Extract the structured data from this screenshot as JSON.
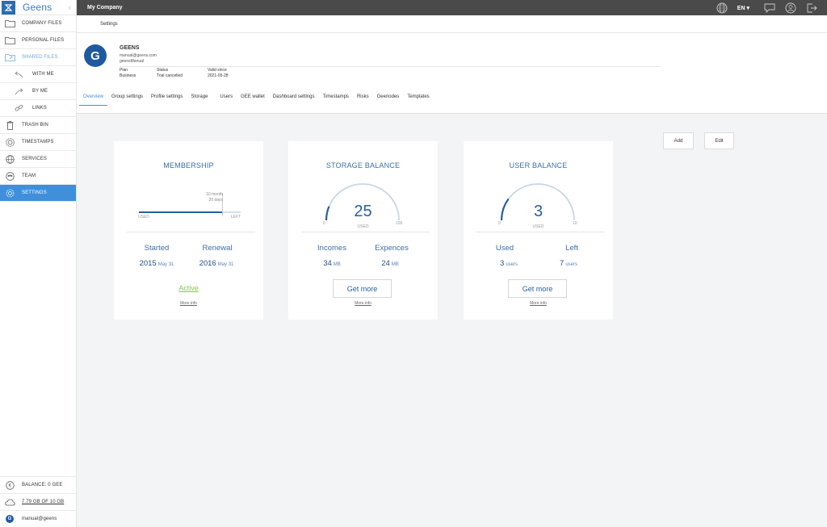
{
  "brand": {
    "name": "Geens"
  },
  "sidebar": {
    "items": [
      {
        "label": "COMPANY FILES",
        "icon": "folder-icon"
      },
      {
        "label": "PERSONAL FILES",
        "icon": "folder-icon"
      },
      {
        "label": "SHARED FILES",
        "icon": "shared-folder-icon"
      },
      {
        "label": "WITH ME",
        "icon": "arrow-back-icon"
      },
      {
        "label": "BY ME",
        "icon": "arrow-forward-icon"
      },
      {
        "label": "LINKS",
        "icon": "link-icon"
      },
      {
        "label": "TRASH BIN",
        "icon": "trash-icon"
      },
      {
        "label": "TIMESTAMPS",
        "icon": "timestamp-icon"
      },
      {
        "label": "SERVICES",
        "icon": "globe-icon"
      },
      {
        "label": "TEAM",
        "icon": "team-icon"
      },
      {
        "label": "SETTINGS",
        "icon": "gear-icon"
      }
    ],
    "bottom": {
      "balance": "BALANCE: 0 GEE",
      "storage": "7.79 GB OF 10 GB",
      "user": "manual@geens"
    }
  },
  "topbar": {
    "company": "My Company",
    "language": "EN"
  },
  "breadcrumb": "Settings",
  "profile": {
    "name": "GEENS",
    "email": "manual@geens.com",
    "username": "geensManual",
    "plan_label": "Plan",
    "plan_value": "Business",
    "status_label": "Status",
    "status_value": "Trial cancelled",
    "valid_label": "Valid since",
    "valid_value": "2021-05-28"
  },
  "tabs": [
    "Overview",
    "Group settings",
    "Profile settings",
    "Storage",
    "Users",
    "GEE wallet",
    "Dashboard settings",
    "Timestamps",
    "Risks",
    "Geenodes",
    "Templates"
  ],
  "actions": {
    "add": "Add",
    "edit": "Edit"
  },
  "membership": {
    "title": "MEMBERSHIP",
    "remaining": "10 month",
    "remaining_days": "20 days",
    "used_label": "USED",
    "left_label": "LEFT",
    "progress_used_fraction": 0.82,
    "started_label": "Started",
    "started_year": "2015",
    "started_date": "May 31",
    "renewal_label": "Renewal",
    "renewal_year": "2016",
    "renewal_date": "May 31",
    "status": "Active",
    "more": "More info"
  },
  "storage": {
    "title": "STORAGE BALANCE",
    "value": "25",
    "used_label": "USED",
    "min": "0",
    "max": "100",
    "incomes_label": "Incomes",
    "incomes_value": "34",
    "incomes_unit": "MB",
    "expences_label": "Expences",
    "expences_value": "24",
    "expences_unit": "MB",
    "button": "Get more",
    "more": "More info"
  },
  "users": {
    "title": "USER BALANCE",
    "value": "3",
    "used_label": "USED",
    "min": "0",
    "max": "10",
    "used_stat_label": "Used",
    "used_stat_value": "3",
    "used_stat_unit": "users",
    "left_label": "Left",
    "left_value": "7",
    "left_unit": "users",
    "button": "Get more",
    "more": "More info"
  }
}
